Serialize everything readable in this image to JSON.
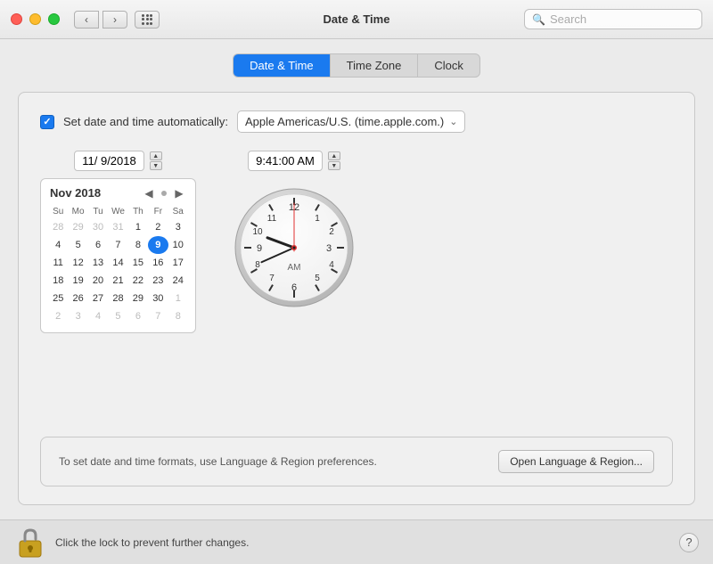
{
  "titlebar": {
    "title": "Date & Time",
    "search_placeholder": "Search"
  },
  "tabs": {
    "items": [
      {
        "id": "date-time",
        "label": "Date & Time",
        "active": true
      },
      {
        "id": "time-zone",
        "label": "Time Zone",
        "active": false
      },
      {
        "id": "clock",
        "label": "Clock",
        "active": false
      }
    ]
  },
  "auto_set": {
    "label": "Set date and time automatically:",
    "checked": true,
    "server": "Apple Americas/U.S. (time.apple.com.)"
  },
  "date_field": {
    "value": "11/  9/2018"
  },
  "time_field": {
    "value": "9:41:00 AM"
  },
  "calendar": {
    "month_year": "Nov 2018",
    "headers": [
      "Su",
      "Mo",
      "Tu",
      "We",
      "Th",
      "Fr",
      "Sa"
    ],
    "weeks": [
      [
        "28",
        "29",
        "30",
        "31",
        "1",
        "2",
        "3"
      ],
      [
        "4",
        "5",
        "6",
        "7",
        "8",
        "9",
        "10"
      ],
      [
        "11",
        "12",
        "13",
        "14",
        "15",
        "16",
        "17"
      ],
      [
        "18",
        "19",
        "20",
        "21",
        "22",
        "23",
        "24"
      ],
      [
        "25",
        "26",
        "27",
        "28",
        "29",
        "30",
        "1"
      ],
      [
        "2",
        "3",
        "4",
        "5",
        "6",
        "7",
        "8"
      ]
    ],
    "today_row": 1,
    "today_col": 5
  },
  "clock": {
    "am_label": "AM"
  },
  "bottom": {
    "text": "To set date and time formats, use Language & Region preferences.",
    "button_label": "Open Language & Region..."
  },
  "footer": {
    "lock_text": "Click the lock to prevent further changes.",
    "help_label": "?"
  }
}
